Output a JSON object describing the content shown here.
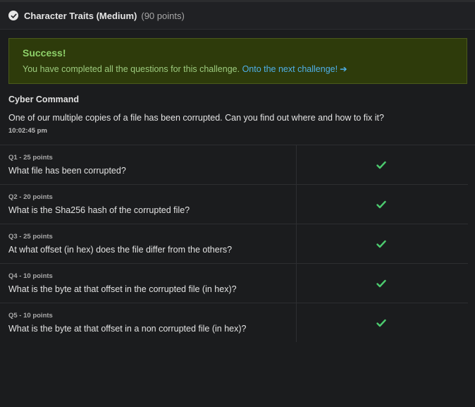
{
  "header": {
    "title": "Character Traits (Medium)",
    "points": "(90 points)"
  },
  "alert": {
    "title": "Success!",
    "message": "You have completed all the questions for this challenge.",
    "link_label": "Onto the next challenge!",
    "arrow": "➔"
  },
  "task": {
    "name": "Cyber Command",
    "description": "One of our multiple copies of a file has been corrupted. Can you find out where and how to fix it?",
    "time": "10:02:45 pm"
  },
  "questions": [
    {
      "meta": "Q1 - 25 points",
      "text": "What file has been corrupted?",
      "status": "complete"
    },
    {
      "meta": "Q2 - 20 points",
      "text": "What is the Sha256 hash of the corrupted file?",
      "status": "complete"
    },
    {
      "meta": "Q3 - 25 points",
      "text": "At what offset (in hex) does the file differ from the others?",
      "status": "complete"
    },
    {
      "meta": "Q4 - 10 points",
      "text": "What is the byte at that offset in the corrupted file (in hex)?",
      "status": "complete"
    },
    {
      "meta": "Q5 - 10 points",
      "text": "What is the byte at that offset in a non corrupted file (in hex)?",
      "status": "complete"
    }
  ],
  "colors": {
    "success_green": "#8ed16a",
    "check_green": "#4ccb6f",
    "link_blue": "#4fb0e8"
  }
}
